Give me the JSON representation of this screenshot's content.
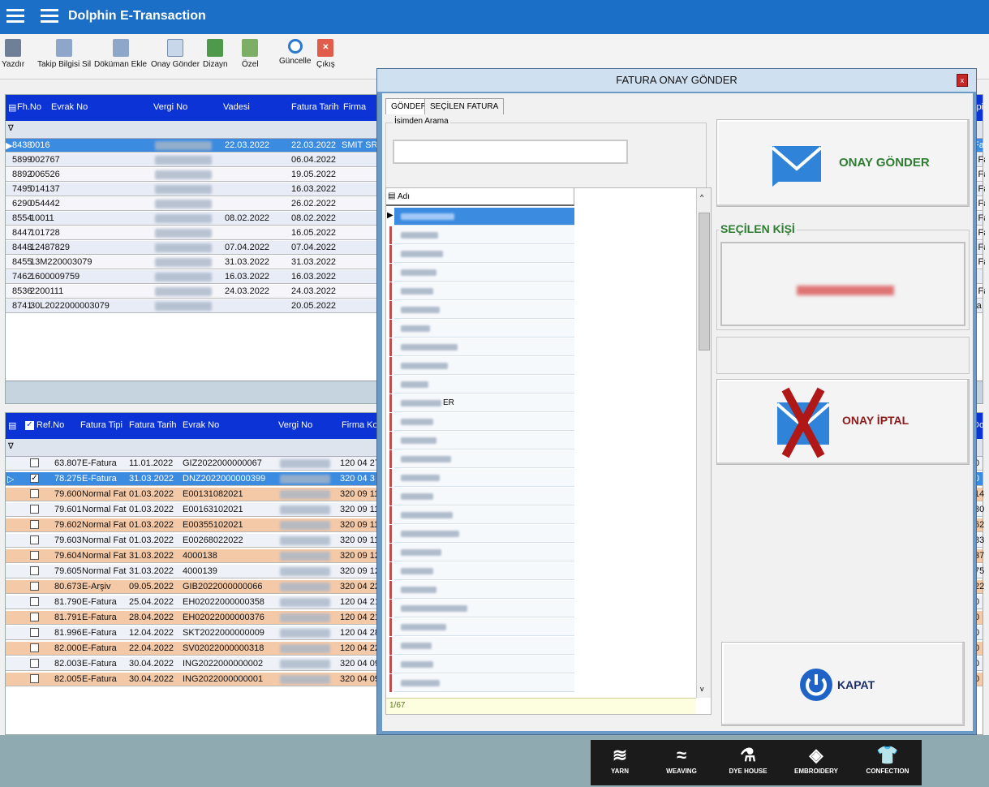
{
  "app": {
    "title": "Dolphin E-Transaction"
  },
  "toolbar": {
    "items": [
      "Yazdır",
      "Takip Bilgisi Sil",
      "Döküman Ekle",
      "Onay Gönder",
      "Dizayn",
      "Özel",
      "Güncelle",
      "Çıkış"
    ]
  },
  "top_grid": {
    "columns": [
      "Fh.No",
      "Evrak No",
      "Vergi No",
      "Vadesi",
      "Fatura Tarih",
      "Firma"
    ],
    "right_columns": [
      "ipi"
    ],
    "rows": [
      {
        "fh": "8438",
        "evrak": "0016",
        "vade": "22.03.2022",
        "tarih": "22.03.2022",
        "firma": "SMIT SR",
        "ipi": "Fa"
      },
      {
        "fh": "5899",
        "evrak": "002767",
        "vade": "",
        "tarih": "06.04.2022",
        "firma": "",
        "ipi": "l Fa"
      },
      {
        "fh": "8892",
        "evrak": "006526",
        "vade": "",
        "tarih": "19.05.2022",
        "firma": "",
        "ipi": "l Fa"
      },
      {
        "fh": "7495",
        "evrak": "014137",
        "vade": "",
        "tarih": "16.03.2022",
        "firma": "",
        "ipi": "l Fa"
      },
      {
        "fh": "6290",
        "evrak": "054442",
        "vade": "",
        "tarih": "26.02.2022",
        "firma": "",
        "ipi": "l Fa"
      },
      {
        "fh": "8554",
        "evrak": "10011",
        "vade": "08.02.2022",
        "tarih": "08.02.2022",
        "firma": "",
        "ipi": "l Fa"
      },
      {
        "fh": "8447",
        "evrak": "101728",
        "vade": "",
        "tarih": "16.05.2022",
        "firma": "",
        "ipi": "l Fa"
      },
      {
        "fh": "8448",
        "evrak": "12487829",
        "vade": "07.04.2022",
        "tarih": "07.04.2022",
        "firma": "",
        "ipi": "l Fa"
      },
      {
        "fh": "8455",
        "evrak": "13M220003079",
        "vade": "31.03.2022",
        "tarih": "31.03.2022",
        "firma": "",
        "ipi": "l Fa"
      },
      {
        "fh": "7462",
        "evrak": "1600009759",
        "vade": "16.03.2022",
        "tarih": "16.03.2022",
        "firma": "",
        "ipi": ""
      },
      {
        "fh": "8536",
        "evrak": "2200111",
        "vade": "24.03.2022",
        "tarih": "24.03.2022",
        "firma": "",
        "ipi": "l Fa"
      },
      {
        "fh": "8741",
        "evrak": "30L2022000003079",
        "vade": "",
        "tarih": "20.05.2022",
        "firma": "",
        "ipi": "ra"
      }
    ]
  },
  "bottom_grid": {
    "columns": [
      "Ref.No",
      "Fatura Tipi",
      "Fatura Tarih",
      "Evrak No",
      "Vergi No",
      "Firma Kodu"
    ],
    "right_columns": [
      "Do"
    ],
    "rows": [
      {
        "ref": "63.807",
        "tip": "E-Fatura",
        "tarih": "11.01.2022",
        "evrak": "GIZ2022000000067",
        "firma": "120 04 27",
        "right": "0"
      },
      {
        "ref": "78.275",
        "tip": "E-Fatura",
        "tarih": "31.03.2022",
        "evrak": "DNZ2022000000399",
        "firma": "320 04 3",
        "right": "0"
      },
      {
        "ref": "79.600",
        "tip": "Normal Fat",
        "tarih": "01.03.2022",
        "evrak": "E00131082021",
        "firma": "320 09 11",
        "right": "14"
      },
      {
        "ref": "79.601",
        "tip": "Normal Fat",
        "tarih": "01.03.2022",
        "evrak": "E00163102021",
        "firma": "320 09 11",
        "right": "30"
      },
      {
        "ref": "79.602",
        "tip": "Normal Fat",
        "tarih": "01.03.2022",
        "evrak": "E00355102021",
        "firma": "320 09 11",
        "right": "62"
      },
      {
        "ref": "79.603",
        "tip": "Normal Fat",
        "tarih": "01.03.2022",
        "evrak": "E00268022022",
        "firma": "320 09 11",
        "right": "83"
      },
      {
        "ref": "79.604",
        "tip": "Normal Fat",
        "tarih": "31.03.2022",
        "evrak": "4000138",
        "firma": "320 09 12",
        "right": "37"
      },
      {
        "ref": "79.605",
        "tip": "Normal Fat",
        "tarih": "31.03.2022",
        "evrak": "4000139",
        "firma": "320 09 12",
        "right": "75"
      },
      {
        "ref": "80.673",
        "tip": "E-Arşiv",
        "tarih": "09.05.2022",
        "evrak": "GIB2022000000066",
        "firma": "320 04 22",
        "right": "22"
      },
      {
        "ref": "81.790",
        "tip": "E-Fatura",
        "tarih": "25.04.2022",
        "evrak": "EH02022000000358",
        "firma": "120 04 21",
        "right": "0"
      },
      {
        "ref": "81.791",
        "tip": "E-Fatura",
        "tarih": "28.04.2022",
        "evrak": "EH02022000000376",
        "firma": "120 04 21",
        "right": "0"
      },
      {
        "ref": "81.996",
        "tip": "E-Fatura",
        "tarih": "12.04.2022",
        "evrak": "SKT2022000000009",
        "firma": "120 04 28",
        "right": "0"
      },
      {
        "ref": "82.000",
        "tip": "E-Fatura",
        "tarih": "22.04.2022",
        "evrak": "SV02022000000318",
        "firma": "120 04 22",
        "right": "0"
      },
      {
        "ref": "82.003",
        "tip": "E-Fatura",
        "tarih": "30.04.2022",
        "evrak": "ING2022000000002",
        "firma": "320 04 09",
        "right": "0"
      },
      {
        "ref": "82.005",
        "tip": "E-Fatura",
        "tarih": "30.04.2022",
        "evrak": "ING2022000000001",
        "firma": "320 04 09",
        "right": "0"
      }
    ]
  },
  "dialog": {
    "title": "FATURA ONAY GÖNDER",
    "close_label": "x",
    "tabs": [
      "GÖNDER",
      "SEÇİLEN FATURA"
    ],
    "search_label": "İsimden Arama",
    "search_value": "",
    "list_header": "Adı",
    "list_visible_suffix": "ER",
    "counter": "1/67",
    "send_label": "ONAY GÖNDER",
    "selected_group": "SEÇİLEN KİŞİ",
    "cancel_label": "ONAY İPTAL",
    "close_button_label": "KAPAT"
  },
  "categories": [
    "YARN",
    "WEAVING",
    "DYE HOUSE",
    "EMBROIDERY",
    "CONFECTION"
  ],
  "colors": {
    "titlebar": "#1c6fc6",
    "grid_header": "#0b33d6",
    "selected_row": "#3b8be0",
    "orange_row": "#f4c9a8",
    "dialog_accent": "#2e7d32"
  }
}
